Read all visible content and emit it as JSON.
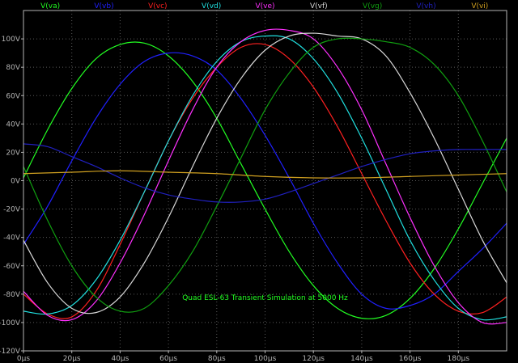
{
  "chart_data": {
    "type": "line",
    "title": "",
    "xlabel": "",
    "ylabel": "",
    "x_unit": "µs",
    "xlim": [
      0,
      200
    ],
    "ylim": [
      -120,
      120
    ],
    "x_ticks": [
      0,
      20,
      40,
      60,
      80,
      100,
      120,
      140,
      160,
      180
    ],
    "y_ticks": [
      -120,
      -100,
      -80,
      -60,
      -40,
      -20,
      0,
      20,
      40,
      60,
      80,
      100
    ],
    "x_tick_labels": [
      "0µs",
      "20µs",
      "40µs",
      "60µs",
      "80µs",
      "100µs",
      "120µs",
      "140µs",
      "160µs",
      "180µs"
    ],
    "y_tick_labels": [
      "-120V",
      "-100V",
      "-80V",
      "-60V",
      "-40V",
      "-20V",
      "0V",
      "20V",
      "40V",
      "60V",
      "80V",
      "100V"
    ],
    "grid": true,
    "legend_position": "top",
    "annotation": {
      "text": "Quad ESL-63 Transient Simulation at 5000 Hz",
      "x": 100,
      "y": -84,
      "color": "#22ff22"
    },
    "series": [
      {
        "name": "V(va)",
        "color": "#22ff22",
        "x": [
          0,
          10,
          20,
          30,
          40,
          50,
          60,
          70,
          80,
          90,
          100,
          110,
          120,
          130,
          140,
          150,
          160,
          170,
          180,
          190,
          200
        ],
        "y": [
          2,
          36,
          65,
          86,
          96,
          97,
          88,
          70,
          44,
          12,
          -20,
          -50,
          -74,
          -90,
          -97,
          -95,
          -83,
          -62,
          -34,
          -2,
          30
        ]
      },
      {
        "name": "V(vb)",
        "color": "#2020ff",
        "x": [
          0,
          10,
          20,
          30,
          40,
          50,
          60,
          70,
          80,
          90,
          100,
          110,
          120,
          130,
          140,
          150,
          160,
          170,
          180,
          190,
          200
        ],
        "y": [
          -45,
          -18,
          14,
          44,
          68,
          84,
          90,
          88,
          78,
          58,
          32,
          2,
          -30,
          -58,
          -80,
          -90,
          -88,
          -80,
          -64,
          -48,
          -30
        ]
      },
      {
        "name": "V(vc)",
        "color": "#ff2020",
        "x": [
          0,
          10,
          20,
          30,
          40,
          50,
          60,
          70,
          80,
          90,
          100,
          110,
          120,
          130,
          140,
          150,
          160,
          170,
          180,
          190,
          200
        ],
        "y": [
          -80,
          -94,
          -96,
          -78,
          -45,
          -8,
          28,
          58,
          80,
          94,
          96,
          86,
          66,
          38,
          5,
          -28,
          -58,
          -80,
          -92,
          -93,
          -82
        ]
      },
      {
        "name": "V(vd)",
        "color": "#20e0e0",
        "x": [
          0,
          10,
          20,
          30,
          40,
          50,
          60,
          70,
          80,
          90,
          100,
          110,
          120,
          130,
          140,
          150,
          160,
          170,
          180,
          190,
          200
        ],
        "y": [
          -92,
          -94,
          -88,
          -70,
          -42,
          -8,
          28,
          60,
          84,
          98,
          102,
          100,
          86,
          62,
          30,
          -6,
          -42,
          -70,
          -90,
          -98,
          -96
        ]
      },
      {
        "name": "V(ve)",
        "color": "#ff30ff",
        "x": [
          0,
          10,
          20,
          30,
          40,
          50,
          60,
          70,
          80,
          90,
          100,
          110,
          120,
          130,
          140,
          150,
          160,
          170,
          180,
          190,
          200
        ],
        "y": [
          -78,
          -95,
          -98,
          -85,
          -58,
          -24,
          14,
          50,
          80,
          98,
          106,
          106,
          100,
          80,
          50,
          12,
          -26,
          -60,
          -86,
          -100,
          -100
        ]
      },
      {
        "name": "V(vf)",
        "color": "#d8d8d8",
        "x": [
          0,
          10,
          20,
          30,
          40,
          50,
          60,
          70,
          80,
          90,
          100,
          110,
          120,
          130,
          140,
          150,
          160,
          170,
          180,
          190,
          200
        ],
        "y": [
          -42,
          -72,
          -90,
          -93,
          -82,
          -58,
          -26,
          10,
          44,
          72,
          92,
          102,
          104,
          102,
          100,
          88,
          62,
          30,
          -6,
          -42,
          -72
        ]
      },
      {
        "name": "V(vg)",
        "color": "#10a010",
        "x": [
          0,
          10,
          20,
          30,
          40,
          50,
          60,
          70,
          80,
          90,
          100,
          110,
          120,
          130,
          140,
          150,
          160,
          170,
          180,
          190,
          200
        ],
        "y": [
          10,
          -28,
          -60,
          -82,
          -92,
          -90,
          -74,
          -50,
          -18,
          16,
          50,
          76,
          94,
          100,
          100,
          98,
          94,
          82,
          60,
          28,
          -8
        ]
      },
      {
        "name": "V(vh)",
        "color": "#2020c0",
        "x": [
          0,
          10,
          20,
          30,
          40,
          50,
          60,
          70,
          80,
          90,
          100,
          110,
          120,
          130,
          140,
          150,
          160,
          170,
          180,
          190,
          200
        ],
        "y": [
          26,
          24,
          17,
          10,
          2,
          -5,
          -10,
          -13,
          -15,
          -15,
          -13,
          -8,
          -2,
          4,
          10,
          15,
          19,
          21,
          22,
          22,
          22
        ]
      },
      {
        "name": "V(vi)",
        "color": "#d0a020",
        "x": [
          0,
          20,
          40,
          60,
          80,
          100,
          120,
          140,
          160,
          180,
          200
        ],
        "y": [
          5,
          6,
          7,
          6,
          5,
          3,
          2,
          2,
          3,
          4,
          5
        ]
      }
    ]
  }
}
